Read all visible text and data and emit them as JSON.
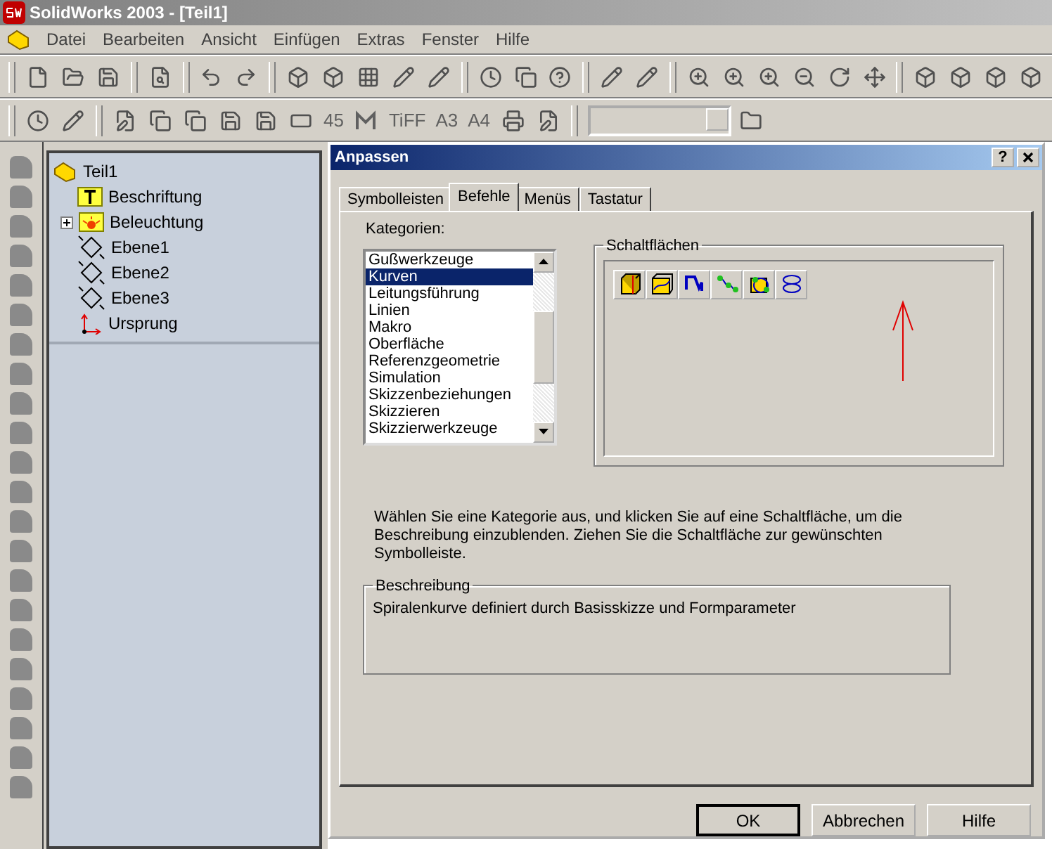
{
  "window": {
    "title": "SolidWorks 2003 - [Teil1]"
  },
  "menu": [
    "Datei",
    "Bearbeiten",
    "Ansicht",
    "Einfügen",
    "Extras",
    "Fenster",
    "Hilfe"
  ],
  "toolbar_labels": [
    "45",
    "TiFF",
    "A3",
    "A4"
  ],
  "tree": {
    "root": "Teil1",
    "children": [
      {
        "name": "Beschriftung",
        "kind": "annotation"
      },
      {
        "name": "Beleuchtung",
        "kind": "lights",
        "expanded": false
      },
      {
        "name": "Ebene1",
        "kind": "plane"
      },
      {
        "name": "Ebene2",
        "kind": "plane"
      },
      {
        "name": "Ebene3",
        "kind": "plane"
      },
      {
        "name": "Ursprung",
        "kind": "origin"
      }
    ]
  },
  "dialog": {
    "title": "Anpassen",
    "help_button": "?",
    "tabs": [
      {
        "label": "Symbolleisten",
        "selected": false
      },
      {
        "label": "Befehle",
        "selected": true
      },
      {
        "label": "Menüs",
        "selected": false
      },
      {
        "label": "Tastatur",
        "selected": false
      }
    ],
    "categories_label": "Kategorien:",
    "categories": [
      {
        "label": "Gußwerkzeuge",
        "selected": false
      },
      {
        "label": "Kurven",
        "selected": true
      },
      {
        "label": "Leitungsführung",
        "selected": false
      },
      {
        "label": "Linien",
        "selected": false
      },
      {
        "label": "Makro",
        "selected": false
      },
      {
        "label": "Oberfläche",
        "selected": false
      },
      {
        "label": "Referenzgeometrie",
        "selected": false
      },
      {
        "label": "Simulation",
        "selected": false
      },
      {
        "label": "Skizzenbeziehungen",
        "selected": false
      },
      {
        "label": "Skizzieren",
        "selected": false
      },
      {
        "label": "Skizzierwerkzeuge",
        "selected": false
      }
    ],
    "buttons_group": "Schaltflächen",
    "instructions": "Wählen Sie eine Kategorie aus, und klicken Sie auf eine Schaltfläche, um die Beschreibung einzublenden. Ziehen Sie die Schaltfläche zur gewünschten Symbolleiste.",
    "description_group": "Beschreibung",
    "description": "Spiralenkurve definiert durch Basisskizze und Formparameter",
    "buttons": [
      "OK",
      "Abbrechen",
      "Hilfe"
    ]
  }
}
